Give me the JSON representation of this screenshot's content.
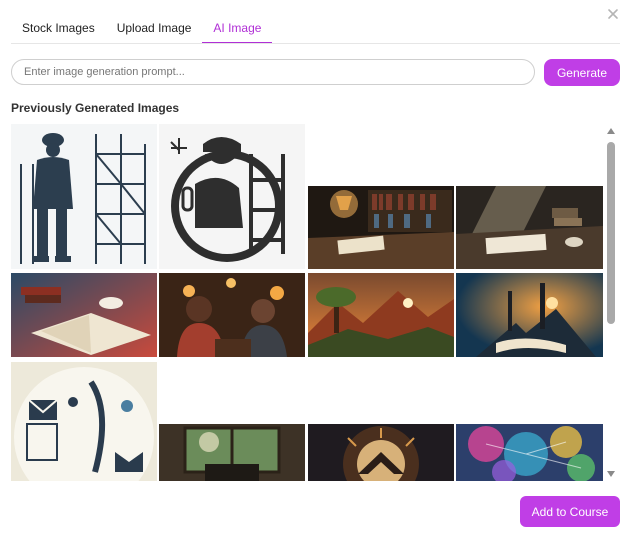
{
  "tabs": [
    {
      "label": "Stock Images",
      "active": false
    },
    {
      "label": "Upload Image",
      "active": false
    },
    {
      "label": "AI Image",
      "active": true
    }
  ],
  "prompt": {
    "value": "",
    "placeholder": "Enter image generation prompt..."
  },
  "generate_label": "Generate",
  "section_title": "Previously Generated Images",
  "add_label": "Add to Course",
  "accent_color": "#c03ee6",
  "thumbnails": [
    {
      "subject": "construction worker and scaffolding line art"
    },
    {
      "subject": "worker on scaffolding icon"
    },
    {
      "subject": "library desk with lamp and books"
    },
    {
      "subject": "desk with papers in sunlight"
    },
    {
      "subject": "open books with coffee cup"
    },
    {
      "subject": "two men talking in cafe"
    },
    {
      "subject": "fantasy landscape with tree and mountains"
    },
    {
      "subject": "fantasy book landscape with towers"
    },
    {
      "subject": "email and writing icons infographic"
    },
    {
      "subject": "window with typewriter"
    },
    {
      "subject": "mystical symbolic artwork"
    },
    {
      "subject": "colorful abstract network"
    }
  ]
}
